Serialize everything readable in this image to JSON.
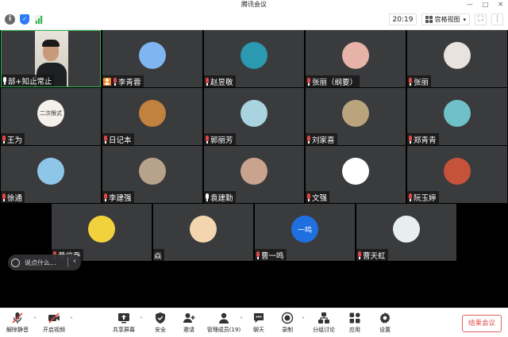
{
  "window": {
    "title": "腾讯会议"
  },
  "topbar": {
    "timer": "20:19",
    "view_label": "宫格视图"
  },
  "tiles": [
    {
      "name": "部+知止常止",
      "mic": "on",
      "host": false,
      "avatar": "camera"
    },
    {
      "name": "李青蓉",
      "mic": "muted",
      "host": true,
      "avatar": "#7fb6f2"
    },
    {
      "name": "赵昱敬",
      "mic": "muted",
      "host": false,
      "avatar": "#2b9ab0"
    },
    {
      "name": "张丽（纲要）",
      "mic": "muted",
      "host": false,
      "avatar": "#e7b3a8"
    },
    {
      "name": "张丽",
      "mic": "muted",
      "host": false,
      "avatar": "#e8e3de"
    },
    {
      "name": "王为",
      "mic": "muted",
      "host": false,
      "avatar": "#f4f0ec",
      "avatar_text": "二次根式"
    },
    {
      "name": "日记本",
      "mic": "muted",
      "host": false,
      "avatar": "#c2813e"
    },
    {
      "name": "郭丽芳",
      "mic": "muted",
      "host": false,
      "avatar": "#a8d3df"
    },
    {
      "name": "刘家喜",
      "mic": "muted",
      "host": false,
      "avatar": "#b9a47e"
    },
    {
      "name": "郑青青",
      "mic": "muted",
      "host": false,
      "avatar": "#6fc0c8"
    },
    {
      "name": "徐通",
      "mic": "muted",
      "host": false,
      "avatar": "#8ec6e8"
    },
    {
      "name": "李建强",
      "mic": "muted",
      "host": false,
      "avatar": "#b7a38c"
    },
    {
      "name": "袁建勤",
      "mic": "on",
      "host": false,
      "avatar": "#caa38e"
    },
    {
      "name": "文强",
      "mic": "muted",
      "host": false,
      "avatar": "#ffffff"
    },
    {
      "name": "阮玉婷",
      "mic": "muted",
      "host": false,
      "avatar": "#c4533a"
    },
    {
      "name": "黄倍乔",
      "mic": "muted",
      "host": false,
      "avatar": "#f2d23c"
    },
    {
      "name": "焱",
      "mic": "none",
      "host": false,
      "avatar": "#f3d6b0"
    },
    {
      "name": "曹一鸣",
      "mic": "muted",
      "host": false,
      "avatar": "#1f6fe0",
      "avatar_text": "一鸣"
    },
    {
      "name": "曹天虹",
      "mic": "muted",
      "host": false,
      "avatar": "#e8eef0"
    }
  ],
  "chat": {
    "placeholder": "说点什么..."
  },
  "toolbar": {
    "items": [
      {
        "label": "解除静音",
        "icon": "mic-muted-icon"
      },
      {
        "label": "开启视频",
        "icon": "video-off-icon"
      },
      {
        "label": "共享屏幕",
        "icon": "share-screen-icon"
      },
      {
        "label": "安全",
        "icon": "shield-icon"
      },
      {
        "label": "邀请",
        "icon": "invite-icon"
      },
      {
        "label": "管理成员(19)",
        "icon": "members-icon"
      },
      {
        "label": "聊天",
        "icon": "chat-icon"
      },
      {
        "label": "录制",
        "icon": "record-icon"
      },
      {
        "label": "分组讨论",
        "icon": "breakout-icon"
      },
      {
        "label": "应用",
        "icon": "apps-icon"
      },
      {
        "label": "设置",
        "icon": "gear-icon"
      }
    ],
    "end_label": "结束会议"
  },
  "colors": {
    "end": "#e04848",
    "signal": "#2fb24c",
    "tile": "#3a3b3d",
    "shield": "#2d7cf6"
  }
}
